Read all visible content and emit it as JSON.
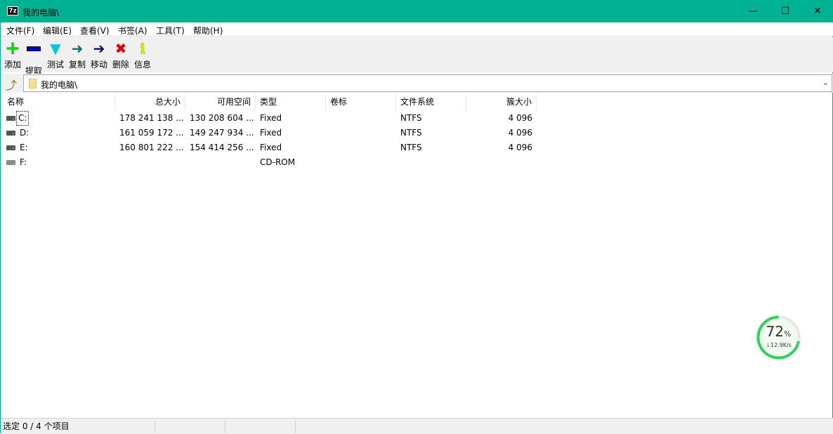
{
  "window": {
    "title": "我的电脑\\",
    "app_icon": "7z"
  },
  "menu": [
    "文件(F)",
    "编辑(E)",
    "查看(V)",
    "书签(A)",
    "工具(T)",
    "帮助(H)"
  ],
  "toolbar": [
    {
      "label": "添加",
      "icon": "plus-icon",
      "color": "#00e000"
    },
    {
      "label": "提取",
      "icon": "minus-icon",
      "color": "#0000cc"
    },
    {
      "label": "测试",
      "icon": "check-chevron-icon",
      "color": "#00c8d8"
    },
    {
      "label": "复制",
      "icon": "copy-arrow-icon",
      "color": "#107070"
    },
    {
      "label": "移动",
      "icon": "move-arrow-icon",
      "color": "#0a0a70"
    },
    {
      "label": "删除",
      "icon": "delete-x-icon",
      "color": "#e00000"
    },
    {
      "label": "信息",
      "icon": "info-icon",
      "color": "#e8e800"
    }
  ],
  "address": {
    "path": "我的电脑\\"
  },
  "columns": [
    "名称",
    "总大小",
    "可用空间",
    "类型",
    "卷标",
    "文件系统",
    "簇大小"
  ],
  "rows": [
    {
      "name": "C:",
      "total": "178 241 138 ...",
      "free": "130 208 604 ...",
      "type": "Fixed",
      "label": "",
      "fs": "NTFS",
      "cluster": "4 096"
    },
    {
      "name": "D:",
      "total": "161 059 172 ...",
      "free": "149 247 934 ...",
      "type": "Fixed",
      "label": "",
      "fs": "NTFS",
      "cluster": "4 096"
    },
    {
      "name": "E:",
      "total": "160 801 222 ...",
      "free": "154 414 256 ...",
      "type": "Fixed",
      "label": "",
      "fs": "NTFS",
      "cluster": "4 096"
    },
    {
      "name": "F:",
      "total": "",
      "free": "",
      "type": "CD-ROM",
      "label": "",
      "fs": "",
      "cluster": ""
    }
  ],
  "status": {
    "selection": "选定 0 / 4 个项目"
  },
  "widget": {
    "percent": "72",
    "percent_sign": "%",
    "speed": "12.9K/s",
    "value": 72
  }
}
